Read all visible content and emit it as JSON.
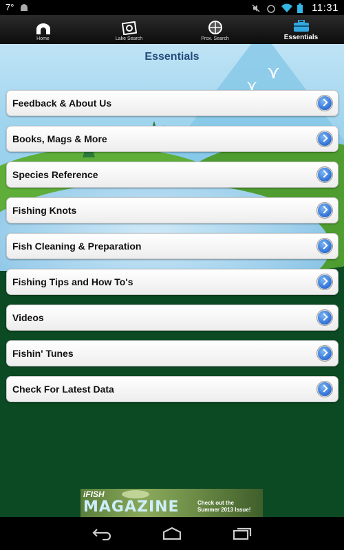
{
  "status_bar": {
    "temperature": "7°",
    "time": "11:31"
  },
  "tabs": [
    {
      "label": "Home",
      "icon": "home-icon",
      "active": false
    },
    {
      "label": "Lake Search",
      "icon": "lake-search-icon",
      "active": false
    },
    {
      "label": "Prox. Search",
      "icon": "crosshair-icon",
      "active": false
    },
    {
      "label": "Essentials",
      "icon": "tackle-box-icon",
      "active": true
    }
  ],
  "page": {
    "title": "Essentials"
  },
  "menu": {
    "items": [
      {
        "label": "Feedback & About Us"
      },
      {
        "label": "Books, Mags & More"
      },
      {
        "label": "Species Reference"
      },
      {
        "label": "Fishing Knots"
      },
      {
        "label": "Fish Cleaning & Preparation"
      },
      {
        "label": "Fishing Tips and How To's"
      },
      {
        "label": "Videos"
      },
      {
        "label": "Fishin' Tunes"
      },
      {
        "label": "Check For Latest Data"
      }
    ]
  },
  "ad": {
    "brand": "iFISH",
    "title": "MAGAZINE",
    "cta_line1": "Check out the",
    "cta_line2": "Summer 2013 Issue!"
  },
  "colors": {
    "title": "#234a7a",
    "background_green": "#0b4a22",
    "chevron_blue": "#2d6fd4"
  }
}
